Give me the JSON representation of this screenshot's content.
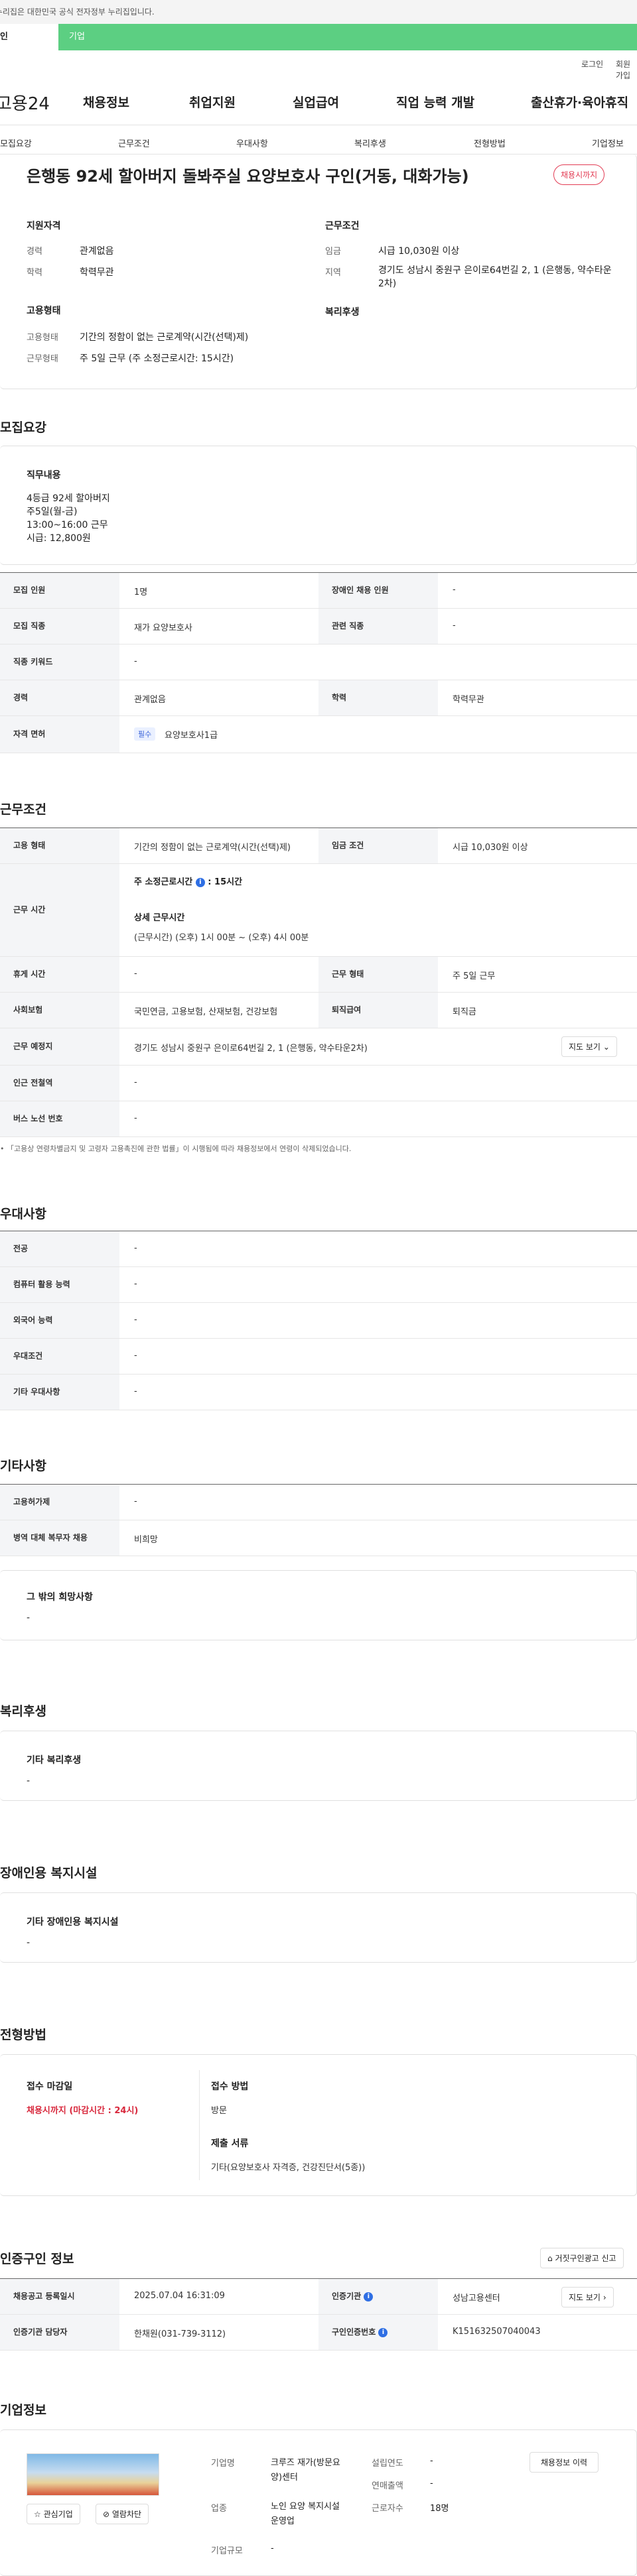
{
  "top_notice": "이 누리집은 대한민국 공식 전자정부 누리집입니다.",
  "tabs": {
    "personal": "개인",
    "company": "기업"
  },
  "util": {
    "login": "로그인",
    "join": "회원가입"
  },
  "logo": "고용24",
  "gnb": [
    "채용정보",
    "취업지원",
    "실업급여",
    "직업 능력 개발",
    "출산휴가·육아휴직"
  ],
  "subnav": [
    "모집요강",
    "근무조건",
    "우대사항",
    "복리후생",
    "전형방법",
    "기업정보"
  ],
  "job": {
    "title": "은행동 92세 할아버지 돌봐주실 요양보호사 구인(거동, 대화가능)",
    "badge": "채용시까지",
    "summary": {
      "qual_title": "지원자격",
      "career_l": "경력",
      "career_v": "관계없음",
      "edu_l": "학력",
      "edu_v": "학력무관",
      "cond_title": "근무조건",
      "wage_l": "임금",
      "wage_v": "시급 10,030원 이상",
      "area_l": "지역",
      "area_v": "경기도 성남시 중원구 은이로64번길 2, 1 (은행동, 약수타운2차)",
      "emp_title": "고용형태",
      "emptype_l": "고용형태",
      "emptype_v": "기간의 정함이 없는 근로계약(시간(선택)제)",
      "worktype_l": "근무형태",
      "worktype_v": "주 5일 근무 (주 소정근로시간: 15시간)",
      "welfare_title": "복리후생"
    }
  },
  "recruit": {
    "title": "모집요강",
    "duty_title": "직무내용",
    "duty_lines": [
      "4등급 92세 할아버지",
      "주5일(월-금)",
      "13:00~16:00 근무",
      "시급: 12,800원"
    ],
    "rows": [
      {
        "l1": "모집 인원",
        "v1": "1명",
        "l2": "장애인 채용 인원",
        "v2": "-"
      },
      {
        "l1": "모집 직종",
        "v1": "재가 요양보호사",
        "l2": "관련 직종",
        "v2": "-"
      },
      {
        "l1": "직종 키워드",
        "v1": "-"
      },
      {
        "l1": "경력",
        "v1": "관계없음",
        "l2": "학력",
        "v2": "학력무관"
      },
      {
        "l1": "자격 면허",
        "tag": "필수",
        "v1": "요양보호사1급"
      }
    ]
  },
  "cond": {
    "title": "근무조건",
    "emp_l": "고용 형태",
    "emp_v": "기간의 정함이 없는 근로계약(시간(선택)제)",
    "wage_l": "임금 조건",
    "wage_v": "시급 10,030원 이상",
    "time_l": "근무 시간",
    "weekly": "주 소정근로시간",
    "weekly_v": "15시간",
    "detail_title": "상세 근무시간",
    "detail_v": "(근무시간) (오후) 1시 00분 ~ (오후) 4시 00분",
    "rest_l": "휴게 시간",
    "rest_v": "-",
    "worktype_l": "근무 형태",
    "worktype_v": "주 5일 근무",
    "ins_l": "사회보험",
    "ins_v": "국민연금, 고용보험, 산재보험, 건강보험",
    "retire_l": "퇴직급여",
    "retire_v": "퇴직금",
    "place_l": "근무 예정지",
    "place_v": "경기도 성남시 중원구 은이로64번길 2, 1 (은행동, 약수타운2차)",
    "map_btn": "지도 보기",
    "subway_l": "인근 전철역",
    "subway_v": "-",
    "bus_l": "버스 노선 번호",
    "bus_v": "-",
    "note": "「고용상 연령차별금지 및 고령자 고용촉진에 관한 법률」이 시행됨에 따라 채용정보에서 연령이 삭제되었습니다."
  },
  "pref": {
    "title": "우대사항",
    "rows": [
      [
        "전공",
        "-"
      ],
      [
        "컴퓨터 활용 능력",
        "-"
      ],
      [
        "외국어 능력",
        "-"
      ],
      [
        "우대조건",
        "-"
      ],
      [
        "기타 우대사항",
        "-"
      ]
    ]
  },
  "etc": {
    "title": "기타사항",
    "rows": [
      [
        "고용허가제",
        "-"
      ],
      [
        "병역 대체 복무자 채용",
        "비희망"
      ]
    ],
    "other_title": "그 밖의 희망사항",
    "other_v": "-"
  },
  "welfare": {
    "title": "복리후생",
    "box_title": "기타 복리후생",
    "box_v": "-"
  },
  "disabled": {
    "title": "장애인용 복지시설",
    "box_title": "기타 장애인용 복지시설",
    "box_v": "-"
  },
  "process": {
    "title": "전형방법",
    "deadline_l": "접수 마감일",
    "deadline_v": "채용시까지 (마감시간 : 24시)",
    "method_l": "접수 방법",
    "method_v": "방문",
    "docs_l": "제출 서류",
    "docs_v": "기타(요양보호사 자격증, 건강진단서(5종))"
  },
  "cert": {
    "title": "인증구인 정보",
    "report_btn": "거짓구인광고 신고",
    "reg_l": "채용공고 등록일시",
    "reg_v": "2025.07.04 16:31:09",
    "org_l": "인증기관",
    "org_v": "성남고용센터",
    "map_btn": "지도 보기",
    "mgr_l": "인증기관 담당자",
    "mgr_v": "한채원(031-739-3112)",
    "no_l": "구인인증번호",
    "no_v": "K151632507040043"
  },
  "company": {
    "title": "기업정보",
    "name_l": "기업명",
    "name_v": "크루즈 재가(방문요양)센터",
    "found_l": "설립연도",
    "found_v": "-",
    "sales_l": "연매출액",
    "sales_v": "-",
    "biz_l": "업종",
    "biz_v": "노인 요양 복지시설 운영업",
    "emp_l": "근로자수",
    "emp_v": "18명",
    "size_l": "기업규모",
    "size_v": "-",
    "fav_btn": "관심기업",
    "block_btn": "열람차단",
    "history_btn": "채용정보 이력"
  }
}
